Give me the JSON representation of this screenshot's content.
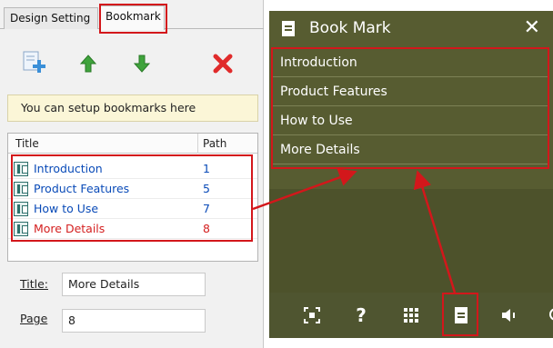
{
  "left_panel": {
    "tabs": [
      {
        "label": "Design Setting"
      },
      {
        "label": "Bookmark"
      }
    ],
    "toolbar": {
      "add_icon": "add-bookmark-icon",
      "up_icon": "arrow-up-icon",
      "down_icon": "arrow-down-icon",
      "delete_icon": "delete-icon"
    },
    "info_text": "You can setup bookmarks here",
    "list": {
      "columns": {
        "title": "Title",
        "path": "Path"
      },
      "rows": [
        {
          "title": "Introduction",
          "path": "1"
        },
        {
          "title": "Product Features",
          "path": "5"
        },
        {
          "title": "How to Use",
          "path": "7"
        },
        {
          "title": "More Details",
          "path": "8"
        }
      ],
      "selected_row": "More Details"
    },
    "fields": {
      "title_label": "Title:",
      "title_value": "More Details",
      "page_label": "Page",
      "page_value": "8"
    }
  },
  "viewer": {
    "header_title": "Book Mark",
    "close_label": "✕",
    "items": [
      {
        "label": "Introduction"
      },
      {
        "label": "Product Features"
      },
      {
        "label": "How to Use"
      },
      {
        "label": "More Details"
      }
    ],
    "bottom_bar": {
      "help_label": "?",
      "icons": [
        "fit-screen-icon",
        "help-icon",
        "thumbnails-icon",
        "bookmark-icon",
        "sound-icon",
        "zoom-icon"
      ]
    }
  },
  "colors": {
    "viewer_bg": "#575c31",
    "highlight": "#d3171b",
    "link_blue": "#0a4bb8",
    "selected_red": "#d42020"
  }
}
